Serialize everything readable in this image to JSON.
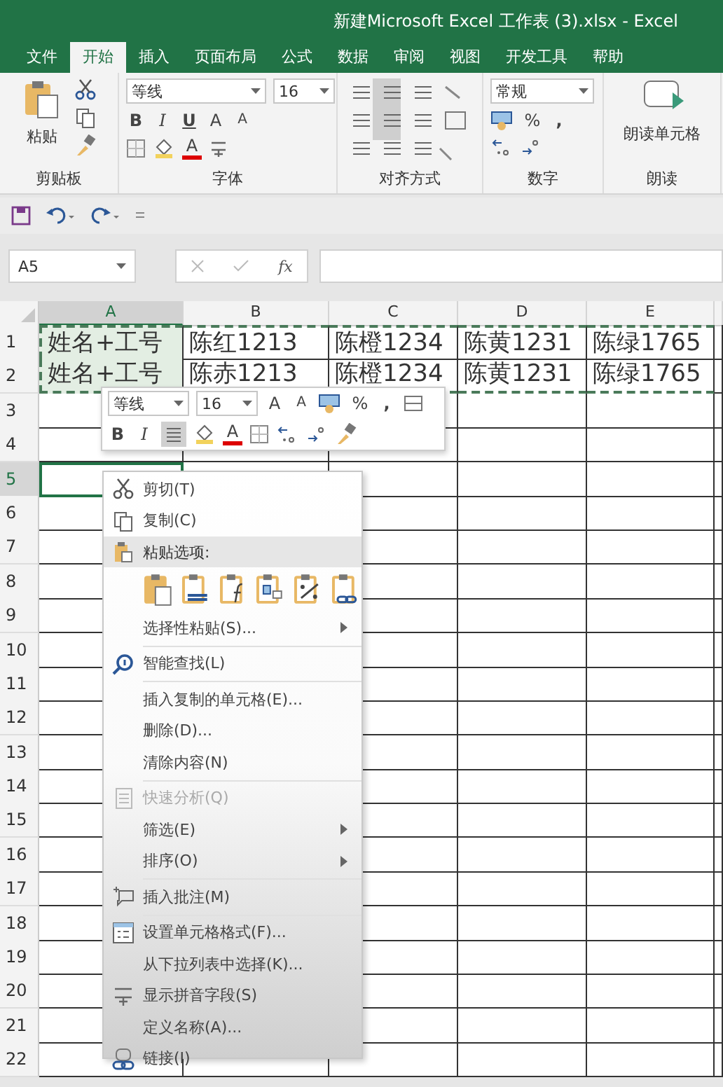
{
  "window": {
    "title": "新建Microsoft Excel 工作表 (3).xlsx  -  Excel"
  },
  "tabs": [
    {
      "label": "文件",
      "selected": false
    },
    {
      "label": "开始",
      "selected": true
    },
    {
      "label": "插入",
      "selected": false
    },
    {
      "label": "页面布局",
      "selected": false
    },
    {
      "label": "公式",
      "selected": false
    },
    {
      "label": "数据",
      "selected": false
    },
    {
      "label": "审阅",
      "selected": false
    },
    {
      "label": "视图",
      "selected": false
    },
    {
      "label": "开发工具",
      "selected": false
    },
    {
      "label": "帮助",
      "selected": false
    }
  ],
  "ribbon": {
    "clipboard": {
      "paste": "粘贴",
      "label": "剪贴板"
    },
    "font": {
      "font_name": "等线",
      "font_size": "16",
      "bold": "B",
      "italic": "I",
      "underline": "U",
      "grow": "A",
      "shrink": "A",
      "font_color_button": "A",
      "label": "字体"
    },
    "alignment": {
      "label": "对齐方式"
    },
    "number": {
      "format": "常规",
      "percent": "%",
      "comma": ",",
      "label": "数字"
    },
    "read": {
      "button": "朗读单元格",
      "label": "朗读"
    }
  },
  "formula_bar": {
    "name_box": "A5",
    "fx": "fx"
  },
  "sheet": {
    "columns": [
      {
        "label": "A",
        "selected": true
      },
      {
        "label": "B",
        "selected": false
      },
      {
        "label": "C",
        "selected": false
      },
      {
        "label": "D",
        "selected": false
      },
      {
        "label": "E",
        "selected": false
      }
    ],
    "rows": [
      {
        "label": "1",
        "selected": false,
        "cells": [
          {
            "text": "姓名+工号",
            "highlighted": true
          },
          {
            "text": "陈红1213",
            "highlighted": false
          },
          {
            "text": "陈橙1234",
            "highlighted": false
          },
          {
            "text": "陈黄1231",
            "highlighted": false
          },
          {
            "text": "陈绿1765",
            "highlighted": false
          }
        ]
      },
      {
        "label": "2",
        "selected": false,
        "cells": [
          {
            "text": "姓名+工号",
            "highlighted": true
          },
          {
            "text": "陈赤1213",
            "highlighted": false
          },
          {
            "text": "陈橙1234",
            "highlighted": false
          },
          {
            "text": "陈黄1231",
            "highlighted": false
          },
          {
            "text": "陈绿1765",
            "highlighted": false
          }
        ]
      },
      {
        "label": "3",
        "selected": false
      },
      {
        "label": "4",
        "selected": false
      },
      {
        "label": "5",
        "selected": true
      },
      {
        "label": "6",
        "selected": false
      },
      {
        "label": "7",
        "selected": false
      },
      {
        "label": "8",
        "selected": false
      },
      {
        "label": "9",
        "selected": false
      },
      {
        "label": "10",
        "selected": false
      },
      {
        "label": "11",
        "selected": false
      },
      {
        "label": "12",
        "selected": false
      },
      {
        "label": "13",
        "selected": false
      },
      {
        "label": "14",
        "selected": false
      },
      {
        "label": "15",
        "selected": false
      },
      {
        "label": "16",
        "selected": false
      },
      {
        "label": "17",
        "selected": false
      },
      {
        "label": "18",
        "selected": false
      },
      {
        "label": "19",
        "selected": false
      },
      {
        "label": "20",
        "selected": false
      },
      {
        "label": "21",
        "selected": false
      },
      {
        "label": "22",
        "selected": false
      }
    ]
  },
  "mini_toolbar": {
    "font_name": "等线",
    "font_size": "16",
    "grow": "A",
    "shrink": "A",
    "percent": "%",
    "comma": ",",
    "bold": "B",
    "italic": "I",
    "font_color_button": "A"
  },
  "context_menu": [
    {
      "kind": "cut",
      "label": "剪切(T)",
      "disabled": false,
      "submenu": false
    },
    {
      "kind": "copy",
      "label": "复制(C)",
      "disabled": false,
      "submenu": false
    },
    {
      "kind": "paste-header",
      "label": "粘贴选项:"
    },
    {
      "kind": "paste-options"
    },
    {
      "kind": "item",
      "label": "选择性粘贴(S)...",
      "disabled": false,
      "submenu": true
    },
    {
      "kind": "separator"
    },
    {
      "kind": "lookup",
      "label": "智能查找(L)",
      "disabled": false,
      "submenu": false
    },
    {
      "kind": "separator"
    },
    {
      "kind": "item",
      "label": "插入复制的单元格(E)...",
      "disabled": false,
      "submenu": false
    },
    {
      "kind": "item",
      "label": "删除(D)...",
      "disabled": false,
      "submenu": false
    },
    {
      "kind": "item",
      "label": "清除内容(N)",
      "disabled": false,
      "submenu": false
    },
    {
      "kind": "separator"
    },
    {
      "kind": "analysis",
      "label": "快速分析(Q)",
      "disabled": true,
      "submenu": false
    },
    {
      "kind": "item",
      "label": "筛选(E)",
      "disabled": false,
      "submenu": true
    },
    {
      "kind": "item",
      "label": "排序(O)",
      "disabled": false,
      "submenu": true
    },
    {
      "kind": "separator"
    },
    {
      "kind": "comment",
      "label": "插入批注(M)",
      "disabled": false,
      "submenu": false
    },
    {
      "kind": "separator"
    },
    {
      "kind": "format",
      "label": "设置单元格格式(F)...",
      "disabled": false,
      "submenu": false
    },
    {
      "kind": "item",
      "label": "从下拉列表中选择(K)...",
      "disabled": false,
      "submenu": false
    },
    {
      "kind": "phonetic",
      "label": "显示拼音字段(S)",
      "disabled": false,
      "submenu": false
    },
    {
      "kind": "item",
      "label": "定义名称(A)...",
      "disabled": false,
      "submenu": false
    },
    {
      "kind": "link",
      "label": "链接(I)",
      "disabled": false,
      "submenu": false
    }
  ]
}
